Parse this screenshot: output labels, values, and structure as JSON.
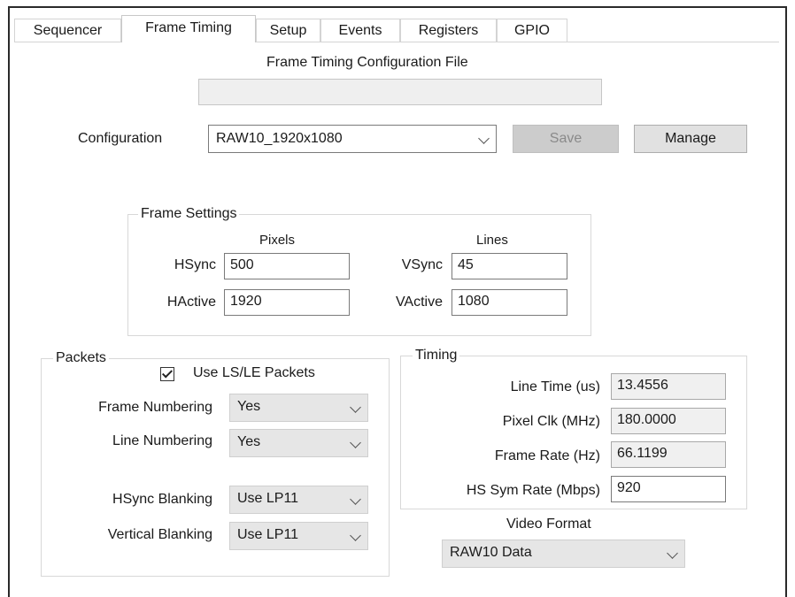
{
  "tabs": [
    {
      "label": "Sequencer",
      "active": false
    },
    {
      "label": "Frame Timing",
      "active": true
    },
    {
      "label": "Setup",
      "active": false
    },
    {
      "label": "Events",
      "active": false
    },
    {
      "label": "Registers",
      "active": false
    },
    {
      "label": "GPIO",
      "active": false
    }
  ],
  "config_file": {
    "label": "Frame Timing Configuration File",
    "value": ""
  },
  "configuration": {
    "label": "Configuration",
    "value": "RAW10_1920x1080",
    "save_label": "Save",
    "manage_label": "Manage"
  },
  "frame_settings": {
    "title": "Frame Settings",
    "pixels_header": "Pixels",
    "lines_header": "Lines",
    "hsync_label": "HSync",
    "hsync_value": "500",
    "hactive_label": "HActive",
    "hactive_value": "1920",
    "vsync_label": "VSync",
    "vsync_value": "45",
    "vactive_label": "VActive",
    "vactive_value": "1080"
  },
  "packets": {
    "title": "Packets",
    "use_lsle_label": "Use LS/LE Packets",
    "use_lsle_checked": true,
    "frame_numbering_label": "Frame Numbering",
    "frame_numbering_value": "Yes",
    "line_numbering_label": "Line Numbering",
    "line_numbering_value": "Yes",
    "hsync_blanking_label": "HSync Blanking",
    "hsync_blanking_value": "Use LP11",
    "vertical_blanking_label": "Vertical Blanking",
    "vertical_blanking_value": "Use LP11"
  },
  "timing": {
    "title": "Timing",
    "line_time_label": "Line Time (us)",
    "line_time_value": "13.4556",
    "pixel_clk_label": "Pixel Clk (MHz)",
    "pixel_clk_value": "180.0000",
    "frame_rate_label": "Frame Rate (Hz)",
    "frame_rate_value": "66.1199",
    "hs_sym_rate_label": "HS Sym Rate (Mbps)",
    "hs_sym_rate_value": "920"
  },
  "video_format": {
    "label": "Video Format",
    "value": "RAW10 Data"
  }
}
